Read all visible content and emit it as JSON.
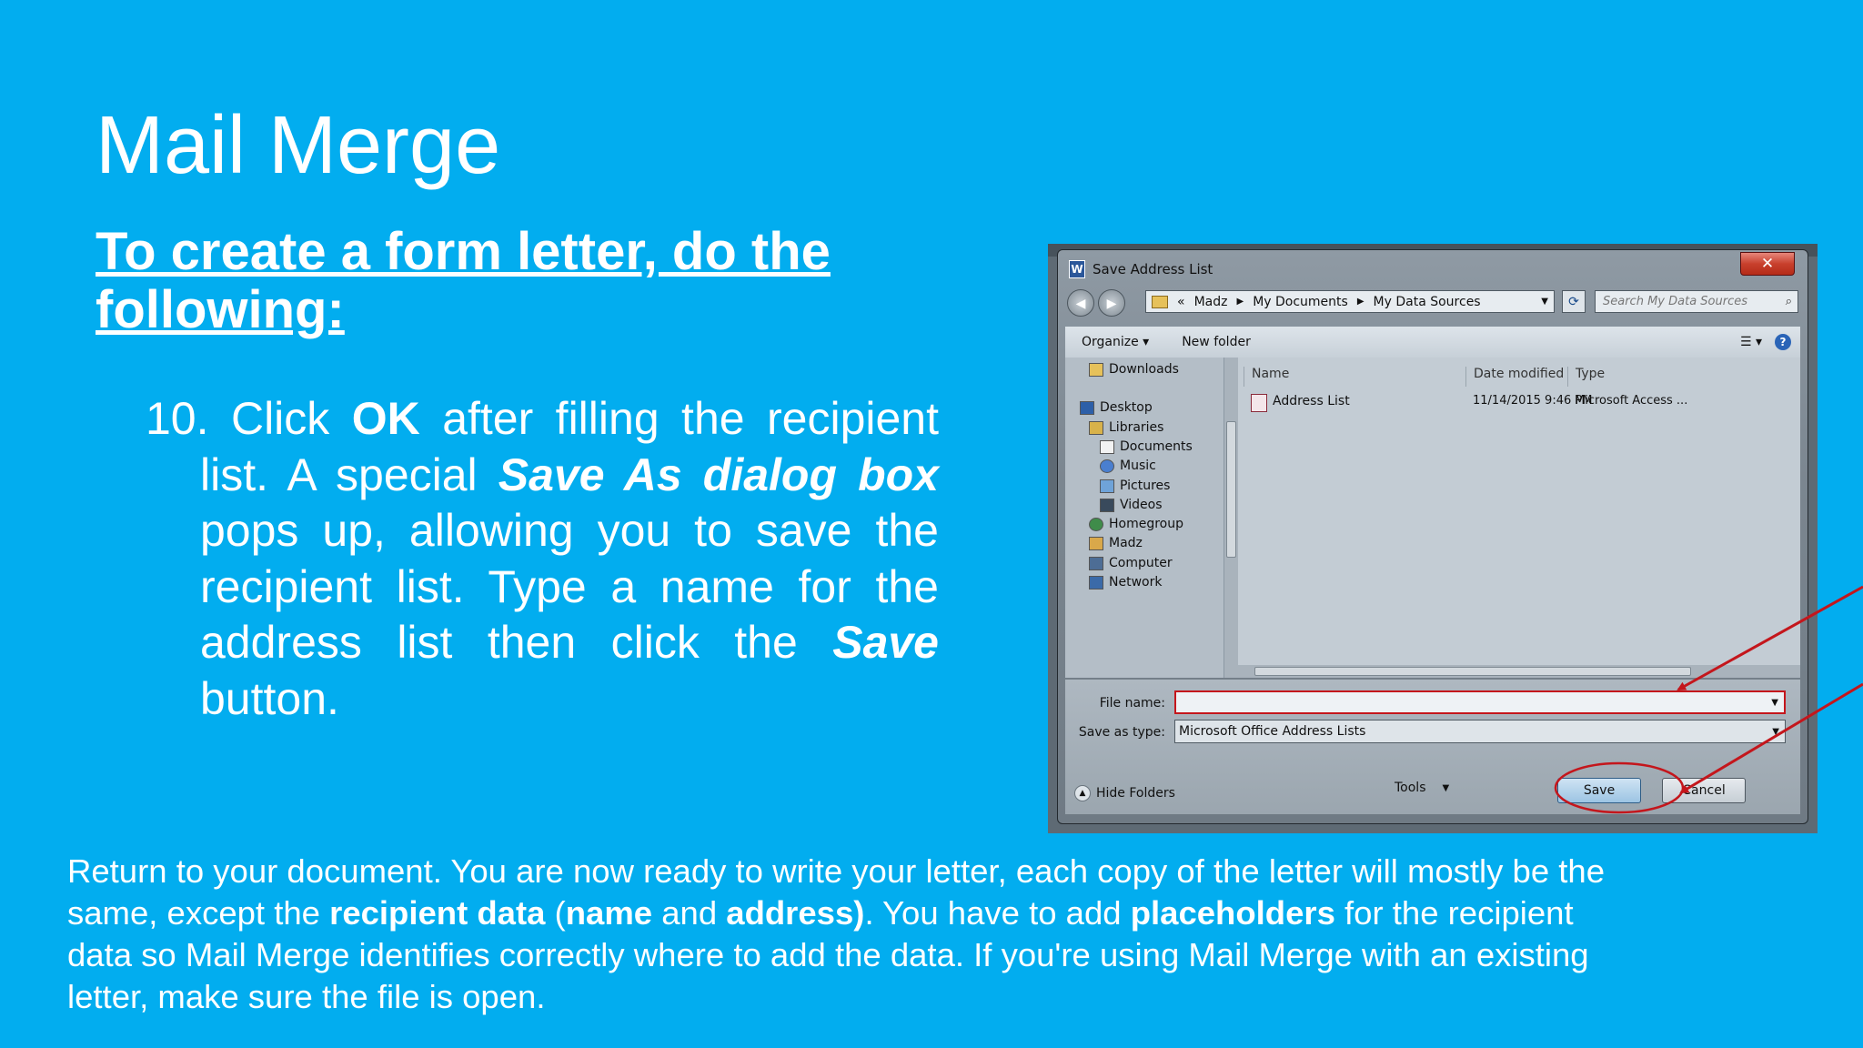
{
  "slide": {
    "title": "Mail Merge",
    "subtitle": "To create a form letter, do the following:",
    "step": {
      "number": "10.",
      "t1": "Click ",
      "b1": "OK",
      "t2": " after filling the recipient list. A special ",
      "i1": "Save As dialog box",
      "t3": " pops up, allowing you to save the recipient list. Type a name for the address list then click the ",
      "i2": "Save",
      "t4": " button."
    },
    "footer": {
      "t1": "Return to your document. You are now ready to write your letter, each copy of the letter will mostly be the same, except the ",
      "b1": "recipient data",
      "t2": " (",
      "b2": "name",
      "t3": " and ",
      "b3": "address)",
      "t4": ". You have to add ",
      "b4": "placeholders",
      "t5": " for the recipient data so Mail Merge identifies correctly where to add the data. If you're using Mail Merge with an existing letter, make sure the file is open."
    }
  },
  "dialog": {
    "title": "Save Address List",
    "app_icon": "W",
    "close_label": "✕",
    "address": {
      "prefix": "«",
      "crumbs": [
        "Madz",
        "My Documents",
        "My Data Sources"
      ]
    },
    "search_placeholder": "Search My Data Sources",
    "toolbar": {
      "organize": "Organize ▾",
      "new_folder": "New folder",
      "help": "?"
    },
    "nav": [
      {
        "label": "Downloads",
        "icon": "downloads-icon"
      },
      {
        "label": "Desktop",
        "icon": "desktop-icon"
      },
      {
        "label": "Libraries",
        "icon": "libraries-icon"
      },
      {
        "label": "Documents",
        "icon": "documents-icon"
      },
      {
        "label": "Music",
        "icon": "music-icon"
      },
      {
        "label": "Pictures",
        "icon": "pictures-icon"
      },
      {
        "label": "Videos",
        "icon": "videos-icon"
      },
      {
        "label": "Homegroup",
        "icon": "homegroup-icon"
      },
      {
        "label": "Madz",
        "icon": "user-folder-icon"
      },
      {
        "label": "Computer",
        "icon": "computer-icon"
      },
      {
        "label": "Network",
        "icon": "network-icon"
      }
    ],
    "columns": {
      "name": "Name",
      "date": "Date modified",
      "type": "Type"
    },
    "files": [
      {
        "name": "Address List",
        "date": "11/14/2015 9:46 PM",
        "type": "Microsoft Access ..."
      }
    ],
    "file_name_label": "File name:",
    "file_name_value": "",
    "save_type_label": "Save as type:",
    "save_type_value": "Microsoft Office Address Lists",
    "hide_folders": "Hide Folders",
    "tools": "Tools",
    "save": "Save",
    "cancel": "Cancel"
  },
  "colors": {
    "background": "#02ADEF",
    "annotation": "#C4161C"
  }
}
